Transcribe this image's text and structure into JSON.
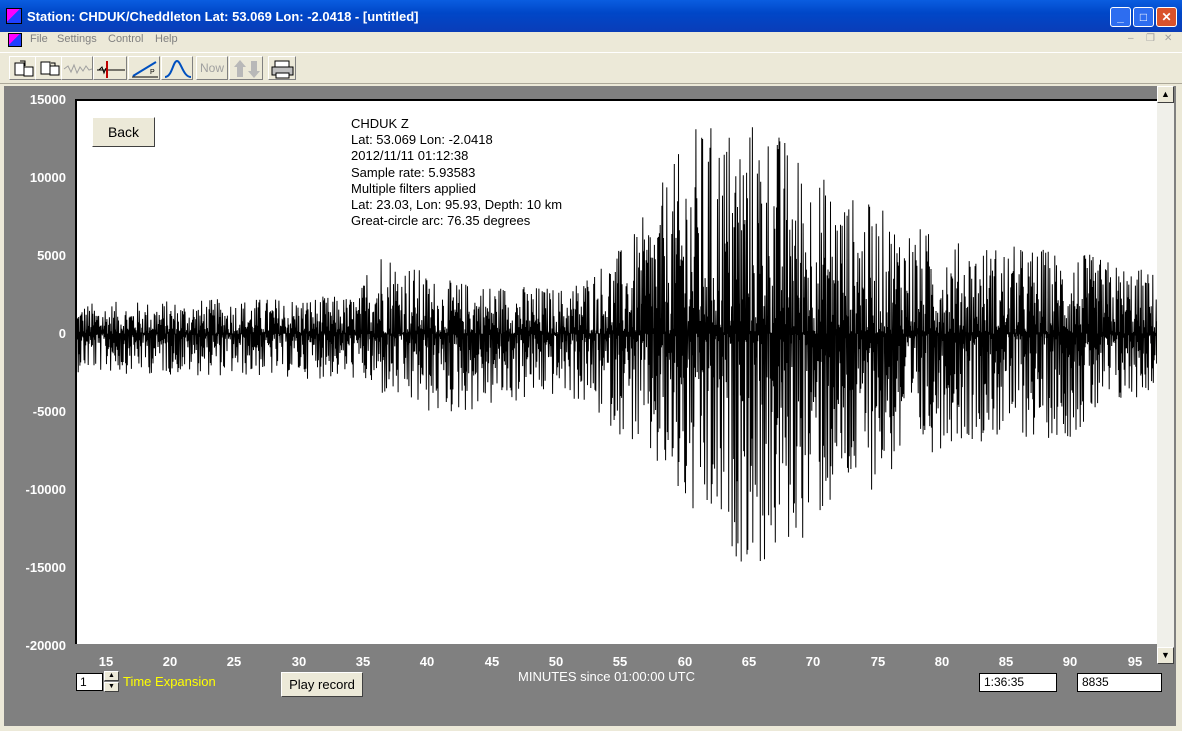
{
  "window": {
    "title": "Station: CHDUK/Cheddleton Lat: 53.069 Lon: -2.0418 - [untitled]",
    "controls": {
      "minimize": "_",
      "maximize": "□",
      "close": "✕"
    }
  },
  "menu": [
    "File",
    "Settings",
    "Control",
    "Help"
  ],
  "toolbar": {
    "icons": [
      "open-file-icon",
      "save-file-icon",
      "waveform-icon",
      "pick-marker-icon",
      "p-wave-icon",
      "spectrum-icon",
      "now-button",
      "up-down-arrows-icon",
      "printer-icon"
    ],
    "now_label": "Now"
  },
  "plot": {
    "back_label": "Back",
    "info_lines": [
      "CHDUK  Z",
      "Lat: 53.069 Lon: -2.0418",
      "2012/11/11 01:12:38",
      "Sample rate: 5.93583",
      "Multiple filters applied",
      "Lat: 23.03, Lon: 95.93, Depth: 10 km",
      "Great-circle arc: 76.35 degrees"
    ],
    "y_ticks": [
      "15000",
      "10000",
      "5000",
      "0",
      "-5000",
      "-10000",
      "-15000",
      "-20000"
    ],
    "x_ticks": [
      "15",
      "20",
      "25",
      "30",
      "35",
      "40",
      "45",
      "50",
      "55",
      "60",
      "65",
      "70",
      "75",
      "80",
      "85",
      "90",
      "95"
    ],
    "x_axis_title": "MINUTES since 01:00:00 UTC"
  },
  "chart_data": {
    "type": "line",
    "xlabel": "MINUTES since 01:00:00 UTC",
    "ylabel": "",
    "xlim": [
      12,
      96
    ],
    "ylim": [
      -20000,
      15000
    ],
    "envelope": [
      {
        "minute": 12,
        "max": 2000,
        "min": -2500
      },
      {
        "minute": 34,
        "max": 2500,
        "min": -3000
      },
      {
        "minute": 35,
        "max": 6200,
        "min": -4000
      },
      {
        "minute": 40,
        "max": 3500,
        "min": -5500
      },
      {
        "minute": 50,
        "max": 3000,
        "min": -4000
      },
      {
        "minute": 55,
        "max": 6000,
        "min": -7000
      },
      {
        "minute": 60,
        "max": 13500,
        "min": -13000
      },
      {
        "minute": 65.5,
        "max": 14200,
        "min": -15700
      },
      {
        "minute": 71,
        "max": 9500,
        "min": -11500
      },
      {
        "minute": 80,
        "max": 6000,
        "min": -7000
      },
      {
        "minute": 89,
        "max": 5500,
        "min": -6800
      },
      {
        "minute": 96,
        "max": 4000,
        "min": -3500
      }
    ]
  },
  "bottom": {
    "time_expansion_value": "1",
    "time_expansion_label": "Time Expansion",
    "play_label": "Play record",
    "time_field": "1:36:35",
    "count_field": "8835"
  }
}
